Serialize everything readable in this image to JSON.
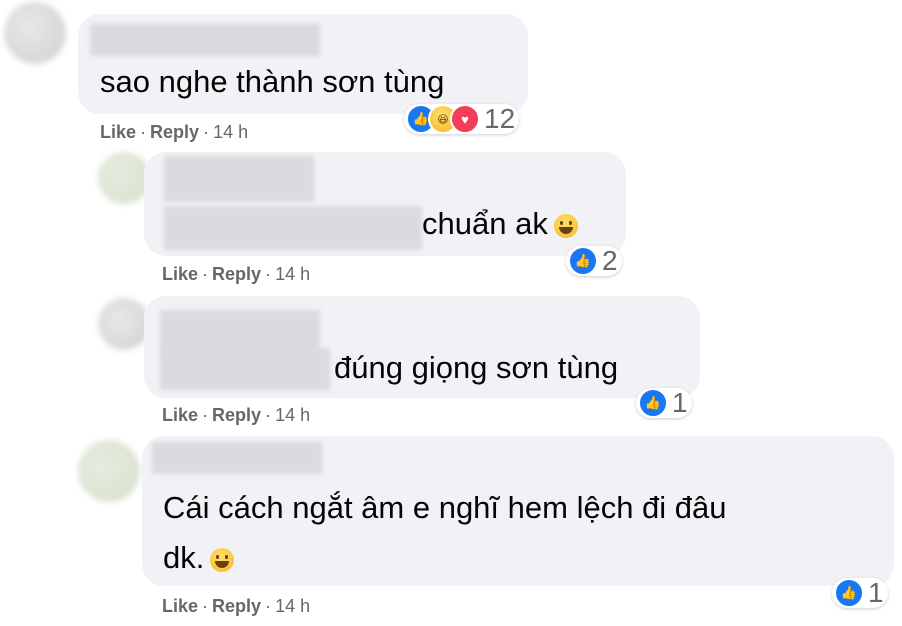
{
  "comments": [
    {
      "text": "sao nghe thành sơn tùng",
      "reactions": [
        "like",
        "haha",
        "love"
      ],
      "reaction_count": "12",
      "like_label": "Like",
      "reply_label": "Reply",
      "separator": "·",
      "time": "14 h"
    },
    {
      "text": "chuẩn ak",
      "emoji": "grinning-face",
      "reactions": [
        "like"
      ],
      "reaction_count": "2",
      "like_label": "Like",
      "reply_label": "Reply",
      "separator": "·",
      "time": "14 h"
    },
    {
      "text": "đúng giọng sơn tùng",
      "reactions": [
        "like"
      ],
      "reaction_count": "1",
      "like_label": "Like",
      "reply_label": "Reply",
      "separator": "·",
      "time": "14 h"
    },
    {
      "text_line1": "Cái cách ngắt âm e nghĩ hem lệch đi đâu",
      "text_line2": "dk.",
      "emoji": "laughing-tears-face",
      "reactions": [
        "like"
      ],
      "reaction_count": "1",
      "like_label": "Like",
      "reply_label": "Reply",
      "separator": "·",
      "time": "14 h"
    }
  ],
  "colors": {
    "bubble": "#f0f2f5",
    "meta": "#65676b",
    "like_blue": "#1877f2",
    "love_red": "#f33e58"
  }
}
